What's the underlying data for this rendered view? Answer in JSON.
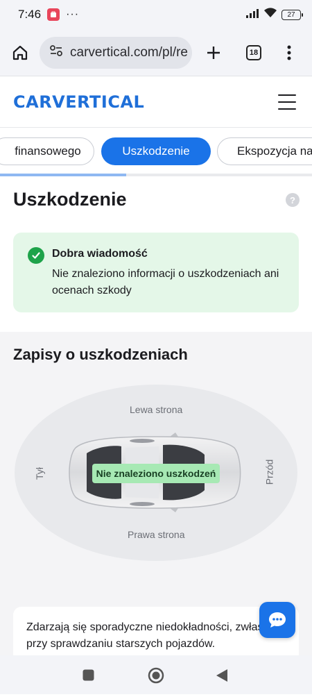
{
  "status_bar": {
    "time": "7:46",
    "dots": "···",
    "battery": "27",
    "icons": [
      "app-notification-icon",
      "signal-icon",
      "wifi-icon",
      "battery-icon"
    ]
  },
  "browser": {
    "url": "carvertical.com/pl/re",
    "tab_count": "18",
    "icons": [
      "home-icon",
      "site-settings-icon",
      "plus-icon",
      "tabs-icon",
      "more-vert-icon"
    ]
  },
  "site": {
    "logo": "CARVERTICAL",
    "menu_icon": "hamburger-icon"
  },
  "tabs": [
    {
      "label": "finansowego",
      "active": false
    },
    {
      "label": "Uszkodzenie",
      "active": true
    },
    {
      "label": "Ekspozycja na",
      "active": false
    }
  ],
  "section": {
    "title": "Uszkodzenie",
    "help": "?"
  },
  "good_news": {
    "title": "Dobra wiadomość",
    "body": "Nie znaleziono informacji o uszkodzeniach ani ocenach szkody"
  },
  "records": {
    "title": "Zapisy o uszkodzeniach",
    "left_side": "Lewa strona",
    "right_side": "Prawa strona",
    "rear": "Tył",
    "front": "Przód",
    "status": "Nie znaleziono uszkodzeń"
  },
  "note": {
    "text": "Zdarzają się sporadyczne niedokładności, zwłaszcza przy sprawdzaniu starszych pojazdów."
  },
  "colors": {
    "accent": "#1a73e8",
    "success_bg": "#e4f7e8",
    "success_icon": "#1ea34a",
    "badge": "#a7e9b4"
  }
}
